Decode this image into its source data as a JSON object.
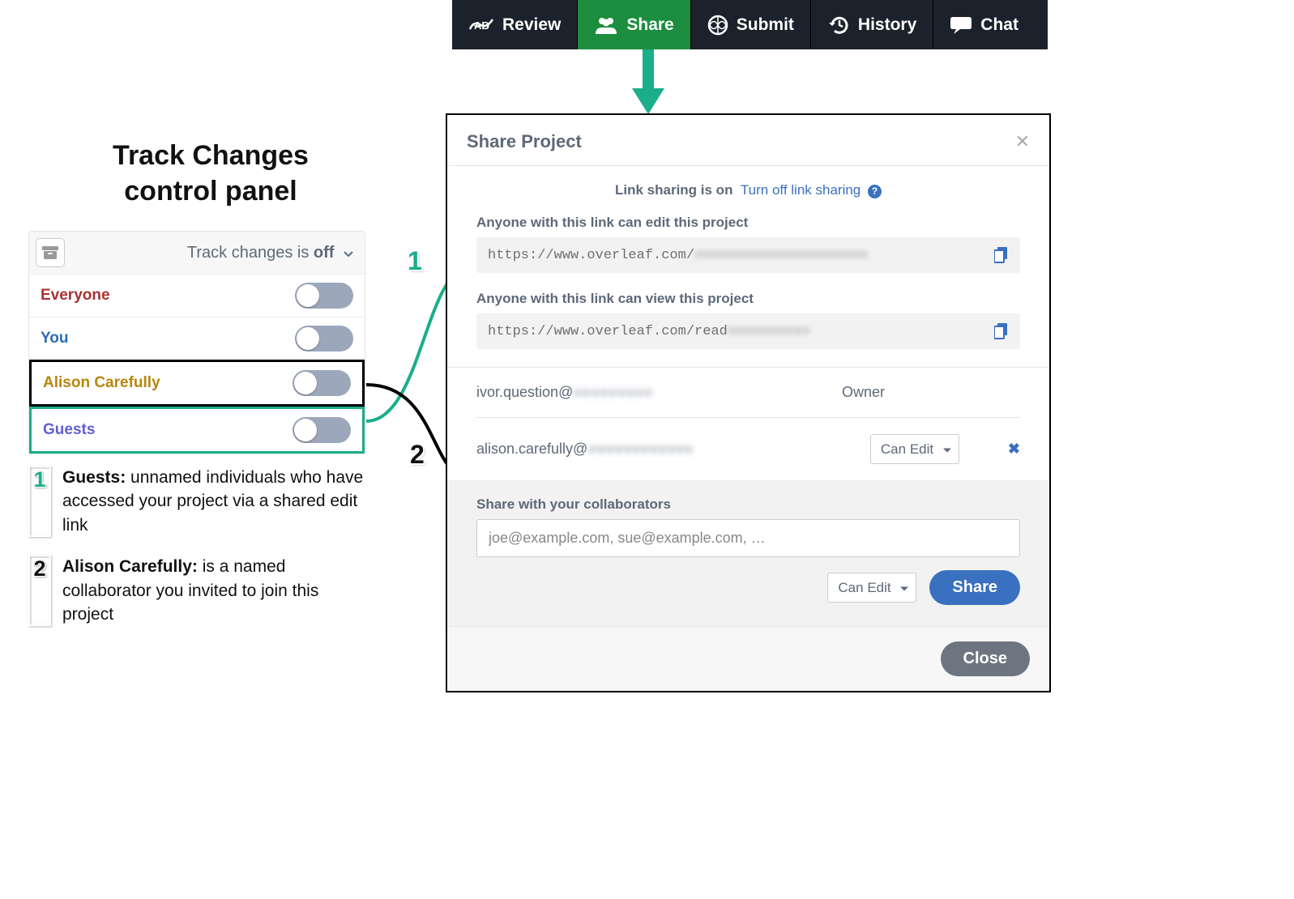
{
  "toolbar": {
    "items": [
      {
        "icon": "review-icon",
        "label": "Review"
      },
      {
        "icon": "share-icon",
        "label": "Share"
      },
      {
        "icon": "submit-icon",
        "label": "Submit"
      },
      {
        "icon": "history-icon",
        "label": "History"
      },
      {
        "icon": "chat-icon",
        "label": "Chat"
      }
    ]
  },
  "left_title_line1": "Track Changes",
  "left_title_line2": "control panel",
  "tc_panel": {
    "status_prefix": "Track changes is ",
    "status_value": "off",
    "rows": [
      {
        "label": "Everyone"
      },
      {
        "label": "You"
      },
      {
        "label": "Alison Carefully"
      },
      {
        "label": "Guests"
      }
    ]
  },
  "annotations": [
    {
      "num": "1",
      "bold": "Guests:",
      "rest": " unnamed individuals who have accessed your project via a shared edit link"
    },
    {
      "num": "2",
      "bold": "Alison Carefully:",
      "rest": " is a named collaborator you invited to join this project"
    }
  ],
  "callouts": {
    "c1": "1",
    "c2": "2"
  },
  "share_modal": {
    "title": "Share Project",
    "link_sharing_prefix": "Link sharing is on",
    "turn_off": "Turn off link sharing",
    "edit_label": "Anyone with this link can edit this project",
    "edit_url": "https://www.overleaf.com/",
    "edit_url_blur": "●●●●●●●●●●●●●●●●●●●●●",
    "view_label": "Anyone with this link can view this project",
    "view_url": "https://www.overleaf.com/read",
    "view_url_blur": "●●●●●●●●●●",
    "collab1_email_prefix": "ivor.question@",
    "collab1_email_blur": "●●●●●●●●●",
    "collab1_role": "Owner",
    "collab2_email_prefix": "alison.carefully@",
    "collab2_email_blur": "●●●●●●●●●●●●",
    "collab2_role": "Can Edit",
    "share_section_label": "Share with your collaborators",
    "share_placeholder": "joe@example.com, sue@example.com, …",
    "share_select": "Can Edit",
    "share_btn": "Share",
    "close_btn": "Close"
  }
}
